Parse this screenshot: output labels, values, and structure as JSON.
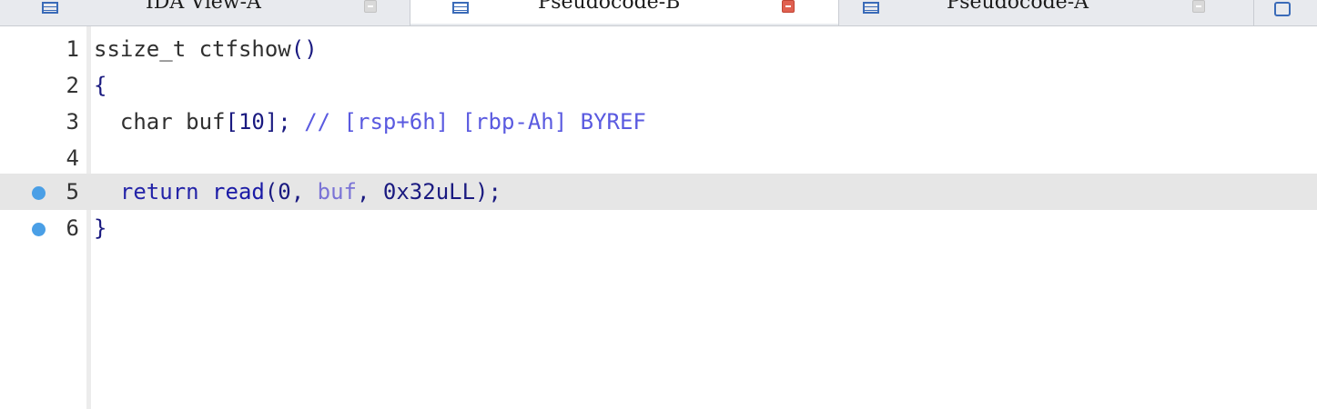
{
  "tabs": [
    {
      "label": "IDA View-A",
      "active": false
    },
    {
      "label": "Pseudocode-B",
      "active": true
    },
    {
      "label": "Pseudocode-A",
      "active": false
    }
  ],
  "colors": {
    "breakpoint": "#4a9fe6",
    "highlight_line": "#e6e6e6",
    "keyword": "#2424a8",
    "variable": "#7a73d6",
    "comment": "#5a5ae0"
  },
  "code": {
    "lines": [
      {
        "number": "1",
        "breakpoint": false,
        "highlighted": false,
        "tokens": [
          {
            "t": "ssize_t ctfshow",
            "c": "plain"
          },
          {
            "t": "()",
            "c": "br"
          }
        ]
      },
      {
        "number": "2",
        "breakpoint": false,
        "highlighted": false,
        "tokens": [
          {
            "t": "{",
            "c": "br"
          }
        ]
      },
      {
        "number": "3",
        "breakpoint": false,
        "highlighted": false,
        "tokens": [
          {
            "t": "  char buf",
            "c": "plain"
          },
          {
            "t": "[10];",
            "c": "br"
          },
          {
            "t": " // [rsp+6h] [rbp-Ah] BYREF",
            "c": "cmt"
          }
        ]
      },
      {
        "number": "4",
        "breakpoint": false,
        "highlighted": false,
        "tokens": []
      },
      {
        "number": "5",
        "breakpoint": true,
        "highlighted": true,
        "tokens": [
          {
            "t": "  return ",
            "c": "kw"
          },
          {
            "t": "read",
            "c": "fn"
          },
          {
            "t": "(0, ",
            "c": "br"
          },
          {
            "t": "buf",
            "c": "var"
          },
          {
            "t": ", 0x32uLL);",
            "c": "br"
          }
        ]
      },
      {
        "number": "6",
        "breakpoint": true,
        "highlighted": false,
        "tokens": [
          {
            "t": "}",
            "c": "br"
          }
        ]
      }
    ]
  }
}
